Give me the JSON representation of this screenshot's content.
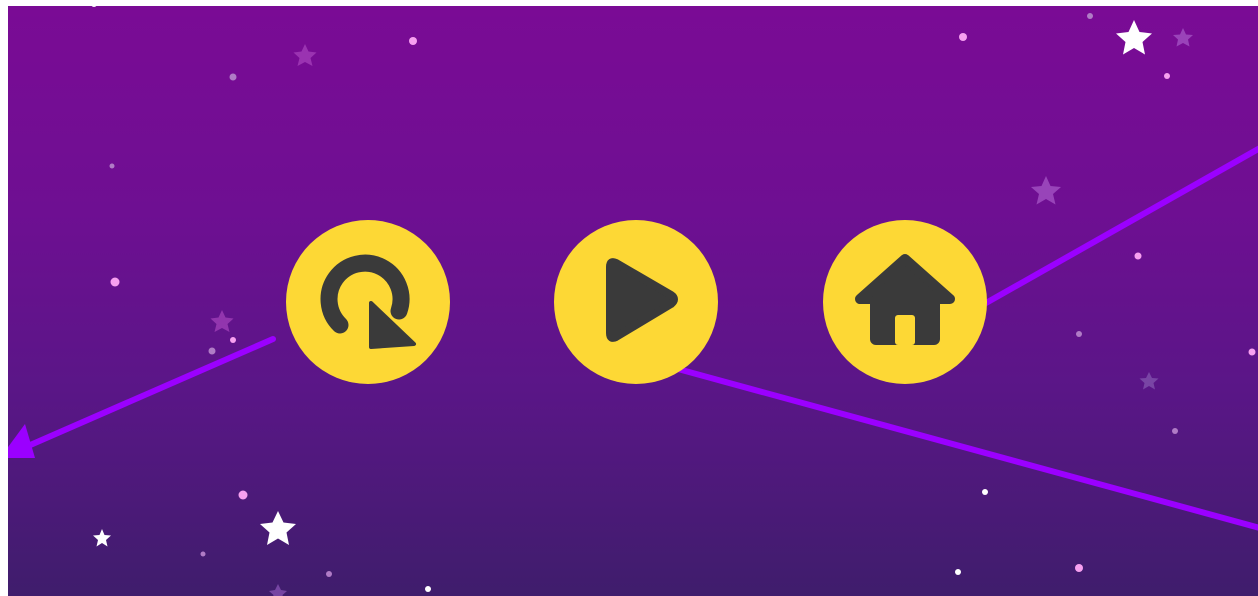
{
  "screen": "pause-menu",
  "colors": {
    "background_top": "#7a0b95",
    "background_bottom": "#3f1d6c",
    "button_fill": "#fdd835",
    "icon_fill": "#3a3a3a",
    "arrow_line": "#9b00ff"
  },
  "buttons": [
    {
      "name": "restart-button",
      "icon": "restart-icon"
    },
    {
      "name": "play-button",
      "icon": "play-icon"
    },
    {
      "name": "home-button",
      "icon": "home-icon"
    }
  ]
}
